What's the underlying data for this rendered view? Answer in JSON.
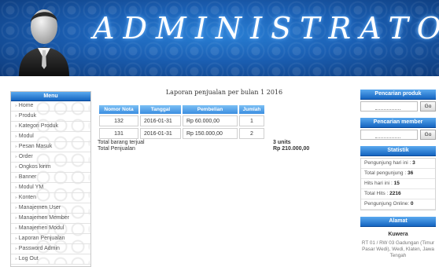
{
  "banner": {
    "title": "ADMINISTRATOR"
  },
  "menu": {
    "header": "Menu",
    "items": [
      "Home",
      "Produk",
      "Kategori Produk",
      "Modul",
      "Pesan Masuk",
      "Order",
      "Ongkos kirim",
      "Banner",
      "Modul YM",
      "Konten",
      "Manajemen User",
      "Manajemen Member",
      "Manajemen Modul",
      "Laporan Penjualan",
      "Password Admin",
      "Log Out"
    ]
  },
  "report": {
    "title": "Laporan penjualan per bulan 1 2016",
    "columns": [
      "Nomor Nota",
      "Tanggal",
      "Pembelian",
      "Jumlah"
    ],
    "rows": [
      [
        "132",
        "2016-01-31",
        "Rp 60.000,00",
        "1"
      ],
      [
        "131",
        "2016-01-31",
        "Rp 150.000,00",
        "2"
      ]
    ],
    "total_items_label": "Total barang terjual",
    "total_items_value": "3 units",
    "total_sales_label": "Total Penjualan",
    "total_sales_value": "Rp 210.000,00"
  },
  "sidebar": {
    "product_search": {
      "header": "Pencarian produk",
      "button": "Go"
    },
    "member_search": {
      "header": "Pencarian member",
      "button": "Go"
    },
    "stats": {
      "header": "Statistik",
      "rows": [
        {
          "label": "Pengunjung hari ini :",
          "value": "3"
        },
        {
          "label": "Total pengunjung :",
          "value": "36"
        },
        {
          "label": "Hits hari ini :",
          "value": "15"
        },
        {
          "label": "Total Hits :",
          "value": "2216"
        },
        {
          "label": "Pengunjung Online:",
          "value": "0"
        }
      ]
    },
    "address": {
      "header": "Alamat",
      "name": "Kuwera",
      "text": "RT 01 / RW 03 Gadungan (Timur Pasar Wedi), Wedi, Klaten, Jawa Tengah"
    }
  },
  "colors": {
    "banner_blue": "#1b5fb3",
    "header_blue": "#1565c0"
  }
}
